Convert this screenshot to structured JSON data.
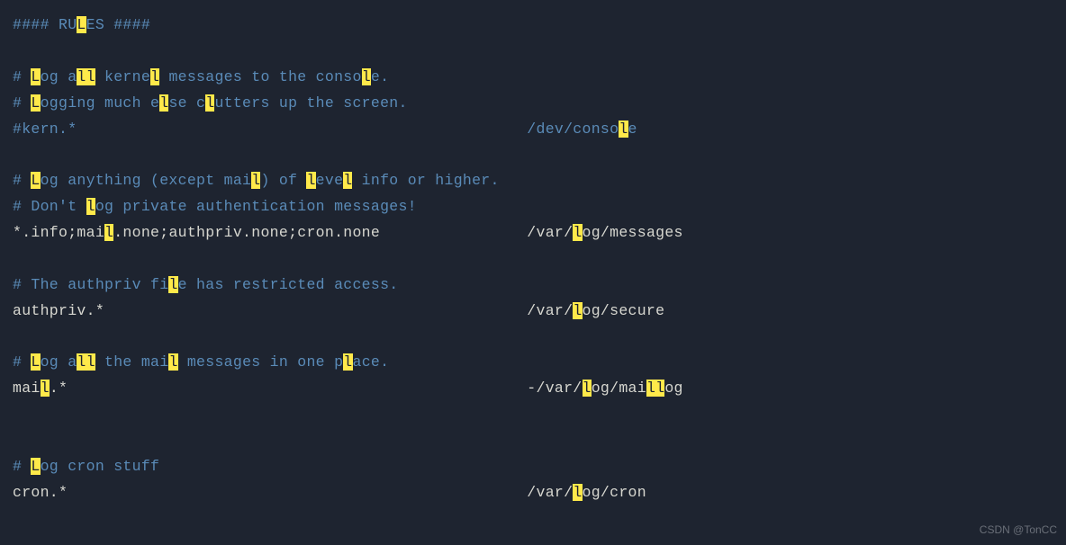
{
  "highlight_char": "l",
  "lines": [
    {
      "segments": [
        {
          "style": "cmt",
          "text": "#### RULES ####"
        }
      ]
    },
    {
      "segments": [
        {
          "style": "cmt",
          "text": ""
        }
      ]
    },
    {
      "segments": [
        {
          "style": "cmt",
          "text": "# Log all kernel messages to the console."
        }
      ]
    },
    {
      "segments": [
        {
          "style": "cmt",
          "text": "# Logging much else clutters up the screen."
        }
      ]
    },
    {
      "segments": [
        {
          "style": "cmt",
          "text": "#kern.*                                                 /dev/console"
        }
      ]
    },
    {
      "segments": [
        {
          "style": "cmt",
          "text": ""
        }
      ]
    },
    {
      "segments": [
        {
          "style": "cmt",
          "text": "# Log anything (except mail) of level info or higher."
        }
      ]
    },
    {
      "segments": [
        {
          "style": "cmt",
          "text": "# Don't log private authentication messages!"
        }
      ]
    },
    {
      "segments": [
        {
          "style": "txt",
          "text": "*.info;mail.none;authpriv.none;cron.none                /var/log/messages"
        }
      ]
    },
    {
      "segments": [
        {
          "style": "cmt",
          "text": ""
        }
      ]
    },
    {
      "segments": [
        {
          "style": "cmt",
          "text": "# The authpriv file has restricted access."
        }
      ]
    },
    {
      "segments": [
        {
          "style": "txt",
          "text": "authpriv.*                                              /var/log/secure"
        }
      ]
    },
    {
      "segments": [
        {
          "style": "cmt",
          "text": ""
        }
      ]
    },
    {
      "segments": [
        {
          "style": "cmt",
          "text": "# Log all the mail messages in one place."
        }
      ]
    },
    {
      "segments": [
        {
          "style": "txt",
          "text": "mail.*                                                  -/var/log/maillog"
        }
      ]
    },
    {
      "segments": [
        {
          "style": "cmt",
          "text": ""
        }
      ]
    },
    {
      "segments": [
        {
          "style": "cmt",
          "text": ""
        }
      ]
    },
    {
      "segments": [
        {
          "style": "cmt",
          "text": "# Log cron stuff"
        }
      ]
    },
    {
      "segments": [
        {
          "style": "txt",
          "text": "cron.*                                                  /var/log/cron"
        }
      ]
    }
  ],
  "watermark": "CSDN @TonCC"
}
